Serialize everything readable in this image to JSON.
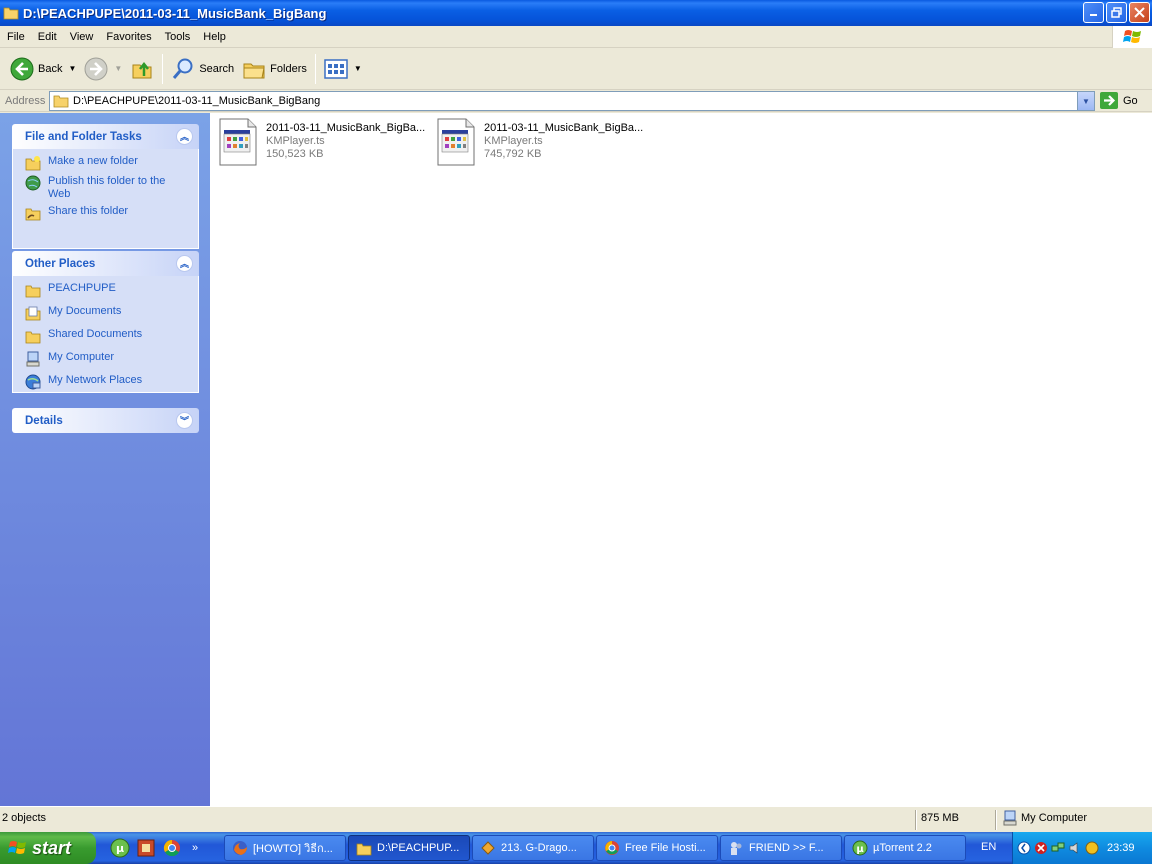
{
  "window": {
    "title": "D:\\PEACHPUPE\\2011-03-11_MusicBank_BigBang"
  },
  "menu": [
    "File",
    "Edit",
    "View",
    "Favorites",
    "Tools",
    "Help"
  ],
  "toolbar": {
    "back_label": "Back",
    "search_label": "Search",
    "folders_label": "Folders"
  },
  "address": {
    "label": "Address",
    "value": "D:\\PEACHPUPE\\2011-03-11_MusicBank_BigBang",
    "go_label": "Go"
  },
  "taskpane": {
    "file_folder_tasks": {
      "title": "File and Folder Tasks",
      "items": [
        "Make a new folder",
        "Publish this folder to the Web",
        "Share this folder"
      ]
    },
    "other_places": {
      "title": "Other Places",
      "items": [
        "PEACHPUPE",
        "My Documents",
        "Shared Documents",
        "My Computer",
        "My Network Places"
      ]
    },
    "details": {
      "title": "Details"
    }
  },
  "files": [
    {
      "name": "2011-03-11_MusicBank_BigBa...",
      "type": "KMPlayer.ts",
      "size": "150,523 KB"
    },
    {
      "name": "2011-03-11_MusicBank_BigBa...",
      "type": "KMPlayer.ts",
      "size": "745,792 KB"
    }
  ],
  "status": {
    "objects": "2 objects",
    "size": "875 MB",
    "zone": "My Computer"
  },
  "taskbar": {
    "start_label": "start",
    "tasks": [
      "[HOWTO] วิธีก...",
      "D:\\PEACHPUP...",
      "213. G-Drago...",
      "Free File Hosti...",
      "FRIEND >> F...",
      "µTorrent 2.2"
    ],
    "language": "EN",
    "clock": "23:39"
  },
  "colors": {
    "title_blue": "#0a5fe4",
    "task_link": "#215dc6",
    "start_green": "#399b2f"
  }
}
